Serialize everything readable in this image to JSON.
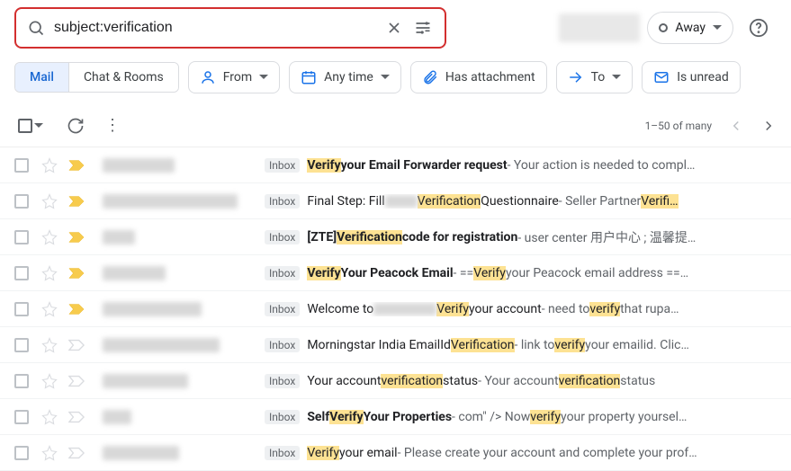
{
  "search": {
    "value": "subject:verification"
  },
  "status": {
    "label": "Away"
  },
  "segments": {
    "mail": "Mail",
    "chat": "Chat & Rooms"
  },
  "chips": {
    "from": "From",
    "anytime": "Any time",
    "attachment": "Has attachment",
    "to": "To",
    "unread": "Is unread"
  },
  "pager": {
    "range": "1–50 of many"
  },
  "labels": {
    "inbox": "Inbox"
  },
  "rows": [
    {
      "important": true,
      "bold": true,
      "senderWidth": 80,
      "parts": [
        {
          "t": "hl",
          "b": true,
          "v": "Verify"
        },
        {
          "t": "txt",
          "b": true,
          "v": " your Email Forwarder request"
        },
        {
          "t": "snip",
          "v": " - Your action is needed to compl…"
        }
      ]
    },
    {
      "important": true,
      "bold": false,
      "senderWidth": 150,
      "parts": [
        {
          "t": "txt",
          "v": "Final Step: Fill "
        },
        {
          "t": "blur",
          "w": 36
        },
        {
          "t": "txt",
          "v": " "
        },
        {
          "t": "hl",
          "v": "Verification"
        },
        {
          "t": "txt",
          "v": " Questionnaire"
        },
        {
          "t": "snip",
          "v": " - Seller Partner "
        },
        {
          "t": "hl",
          "v": "Verifi…"
        }
      ]
    },
    {
      "important": true,
      "bold": true,
      "senderWidth": 36,
      "parts": [
        {
          "t": "txt",
          "b": true,
          "v": "[ZTE]"
        },
        {
          "t": "hl",
          "b": true,
          "v": "Verification"
        },
        {
          "t": "txt",
          "b": true,
          "v": " code for registration"
        },
        {
          "t": "snip",
          "v": " - user center 用户中心 ; 温馨提…"
        }
      ]
    },
    {
      "important": true,
      "bold": true,
      "senderWidth": 70,
      "parts": [
        {
          "t": "hl",
          "b": true,
          "v": "Verify"
        },
        {
          "t": "txt",
          "b": true,
          "v": " Your Peacock Email"
        },
        {
          "t": "snip",
          "v": " - == "
        },
        {
          "t": "hl",
          "v": "Verify"
        },
        {
          "t": "snip",
          "v": " your Peacock email address ==…"
        }
      ]
    },
    {
      "important": true,
      "bold": false,
      "senderWidth": 110,
      "parts": [
        {
          "t": "txt",
          "v": "Welcome to "
        },
        {
          "t": "blur",
          "w": 70
        },
        {
          "t": "txt",
          "v": " "
        },
        {
          "t": "hl",
          "v": "Verify"
        },
        {
          "t": "txt",
          "v": " your account"
        },
        {
          "t": "snip",
          "v": " - need to "
        },
        {
          "t": "hl",
          "v": "verify"
        },
        {
          "t": "snip",
          "v": " that rupa…"
        }
      ]
    },
    {
      "important": false,
      "bold": false,
      "senderWidth": 130,
      "parts": [
        {
          "t": "txt",
          "v": "Morningstar India EmailId "
        },
        {
          "t": "hl",
          "v": "Verification"
        },
        {
          "t": "snip",
          "v": " - link to "
        },
        {
          "t": "hl",
          "v": "verify"
        },
        {
          "t": "snip",
          "v": " your emailid. Clic…"
        }
      ]
    },
    {
      "important": false,
      "bold": false,
      "senderWidth": 95,
      "parts": [
        {
          "t": "txt",
          "v": "Your account "
        },
        {
          "t": "hl",
          "v": "verification"
        },
        {
          "t": "txt",
          "v": " status"
        },
        {
          "t": "snip",
          "v": " - Your account "
        },
        {
          "t": "hl",
          "v": "verification"
        },
        {
          "t": "snip",
          "v": " status"
        }
      ]
    },
    {
      "important": false,
      "bold": true,
      "senderWidth": 32,
      "parts": [
        {
          "t": "txt",
          "b": true,
          "v": "Self "
        },
        {
          "t": "hl",
          "b": true,
          "v": "Verify"
        },
        {
          "t": "txt",
          "b": true,
          "v": " Your Properties"
        },
        {
          "t": "snip",
          "v": " - com\" /> Now "
        },
        {
          "t": "hl",
          "v": "verify"
        },
        {
          "t": "snip",
          "v": " your property yoursel…"
        }
      ]
    },
    {
      "important": false,
      "bold": false,
      "senderWidth": 85,
      "parts": [
        {
          "t": "hl",
          "v": "Verify"
        },
        {
          "t": "txt",
          "v": " your email"
        },
        {
          "t": "snip",
          "v": " - Please create your account and complete your prof…"
        }
      ]
    }
  ]
}
